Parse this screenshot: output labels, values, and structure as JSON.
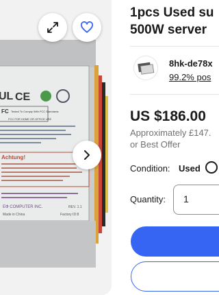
{
  "listing": {
    "title": "1pcs Used su… 500W server…",
    "title_line1": "1pcs Used su",
    "title_line2": "500W server"
  },
  "seller": {
    "name": "8hk-de78x",
    "feedback": "99.2% pos"
  },
  "price": {
    "amount": "US $186.00",
    "approx": "Approximately £147.",
    "best_offer": "or Best Offer"
  },
  "condition": {
    "label": "Condition:",
    "value": "Used"
  },
  "quantity": {
    "label": "Quantity:",
    "value": "1"
  },
  "photo": {
    "label_brand_text": "ЕФ COMPUTER INC.",
    "label_warning": "Achtung!",
    "label_rev": "REV. 1.1",
    "label_made_in": "Made in China",
    "label_factory": "Factory ID:8",
    "label_fcc": "FCC FOR HOME OR OFFICE USE",
    "label_tested": "Tested To Comply With FCC Standards"
  },
  "icons": {
    "expand": "expand-arrows-icon",
    "watch": "heart-icon",
    "next": "chevron-right-icon",
    "seller_avatar": "seller-store-icon",
    "info": "info-icon"
  },
  "colors": {
    "accent": "#3665f3",
    "text": "#191919",
    "muted": "#707070"
  }
}
